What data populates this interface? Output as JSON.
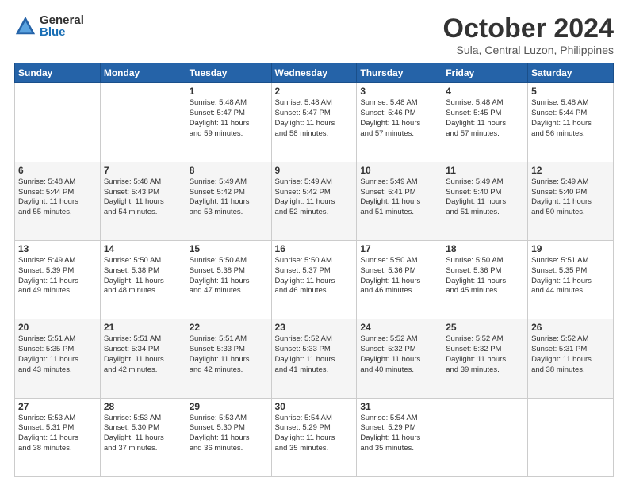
{
  "logo": {
    "general": "General",
    "blue": "Blue"
  },
  "header": {
    "month": "October 2024",
    "location": "Sula, Central Luzon, Philippines"
  },
  "weekdays": [
    "Sunday",
    "Monday",
    "Tuesday",
    "Wednesday",
    "Thursday",
    "Friday",
    "Saturday"
  ],
  "weeks": [
    [
      {
        "day": "",
        "info": ""
      },
      {
        "day": "",
        "info": ""
      },
      {
        "day": "1",
        "info": "Sunrise: 5:48 AM\nSunset: 5:47 PM\nDaylight: 11 hours\nand 59 minutes."
      },
      {
        "day": "2",
        "info": "Sunrise: 5:48 AM\nSunset: 5:47 PM\nDaylight: 11 hours\nand 58 minutes."
      },
      {
        "day": "3",
        "info": "Sunrise: 5:48 AM\nSunset: 5:46 PM\nDaylight: 11 hours\nand 57 minutes."
      },
      {
        "day": "4",
        "info": "Sunrise: 5:48 AM\nSunset: 5:45 PM\nDaylight: 11 hours\nand 57 minutes."
      },
      {
        "day": "5",
        "info": "Sunrise: 5:48 AM\nSunset: 5:44 PM\nDaylight: 11 hours\nand 56 minutes."
      }
    ],
    [
      {
        "day": "6",
        "info": "Sunrise: 5:48 AM\nSunset: 5:44 PM\nDaylight: 11 hours\nand 55 minutes."
      },
      {
        "day": "7",
        "info": "Sunrise: 5:48 AM\nSunset: 5:43 PM\nDaylight: 11 hours\nand 54 minutes."
      },
      {
        "day": "8",
        "info": "Sunrise: 5:49 AM\nSunset: 5:42 PM\nDaylight: 11 hours\nand 53 minutes."
      },
      {
        "day": "9",
        "info": "Sunrise: 5:49 AM\nSunset: 5:42 PM\nDaylight: 11 hours\nand 52 minutes."
      },
      {
        "day": "10",
        "info": "Sunrise: 5:49 AM\nSunset: 5:41 PM\nDaylight: 11 hours\nand 51 minutes."
      },
      {
        "day": "11",
        "info": "Sunrise: 5:49 AM\nSunset: 5:40 PM\nDaylight: 11 hours\nand 51 minutes."
      },
      {
        "day": "12",
        "info": "Sunrise: 5:49 AM\nSunset: 5:40 PM\nDaylight: 11 hours\nand 50 minutes."
      }
    ],
    [
      {
        "day": "13",
        "info": "Sunrise: 5:49 AM\nSunset: 5:39 PM\nDaylight: 11 hours\nand 49 minutes."
      },
      {
        "day": "14",
        "info": "Sunrise: 5:50 AM\nSunset: 5:38 PM\nDaylight: 11 hours\nand 48 minutes."
      },
      {
        "day": "15",
        "info": "Sunrise: 5:50 AM\nSunset: 5:38 PM\nDaylight: 11 hours\nand 47 minutes."
      },
      {
        "day": "16",
        "info": "Sunrise: 5:50 AM\nSunset: 5:37 PM\nDaylight: 11 hours\nand 46 minutes."
      },
      {
        "day": "17",
        "info": "Sunrise: 5:50 AM\nSunset: 5:36 PM\nDaylight: 11 hours\nand 46 minutes."
      },
      {
        "day": "18",
        "info": "Sunrise: 5:50 AM\nSunset: 5:36 PM\nDaylight: 11 hours\nand 45 minutes."
      },
      {
        "day": "19",
        "info": "Sunrise: 5:51 AM\nSunset: 5:35 PM\nDaylight: 11 hours\nand 44 minutes."
      }
    ],
    [
      {
        "day": "20",
        "info": "Sunrise: 5:51 AM\nSunset: 5:35 PM\nDaylight: 11 hours\nand 43 minutes."
      },
      {
        "day": "21",
        "info": "Sunrise: 5:51 AM\nSunset: 5:34 PM\nDaylight: 11 hours\nand 42 minutes."
      },
      {
        "day": "22",
        "info": "Sunrise: 5:51 AM\nSunset: 5:33 PM\nDaylight: 11 hours\nand 42 minutes."
      },
      {
        "day": "23",
        "info": "Sunrise: 5:52 AM\nSunset: 5:33 PM\nDaylight: 11 hours\nand 41 minutes."
      },
      {
        "day": "24",
        "info": "Sunrise: 5:52 AM\nSunset: 5:32 PM\nDaylight: 11 hours\nand 40 minutes."
      },
      {
        "day": "25",
        "info": "Sunrise: 5:52 AM\nSunset: 5:32 PM\nDaylight: 11 hours\nand 39 minutes."
      },
      {
        "day": "26",
        "info": "Sunrise: 5:52 AM\nSunset: 5:31 PM\nDaylight: 11 hours\nand 38 minutes."
      }
    ],
    [
      {
        "day": "27",
        "info": "Sunrise: 5:53 AM\nSunset: 5:31 PM\nDaylight: 11 hours\nand 38 minutes."
      },
      {
        "day": "28",
        "info": "Sunrise: 5:53 AM\nSunset: 5:30 PM\nDaylight: 11 hours\nand 37 minutes."
      },
      {
        "day": "29",
        "info": "Sunrise: 5:53 AM\nSunset: 5:30 PM\nDaylight: 11 hours\nand 36 minutes."
      },
      {
        "day": "30",
        "info": "Sunrise: 5:54 AM\nSunset: 5:29 PM\nDaylight: 11 hours\nand 35 minutes."
      },
      {
        "day": "31",
        "info": "Sunrise: 5:54 AM\nSunset: 5:29 PM\nDaylight: 11 hours\nand 35 minutes."
      },
      {
        "day": "",
        "info": ""
      },
      {
        "day": "",
        "info": ""
      }
    ]
  ]
}
